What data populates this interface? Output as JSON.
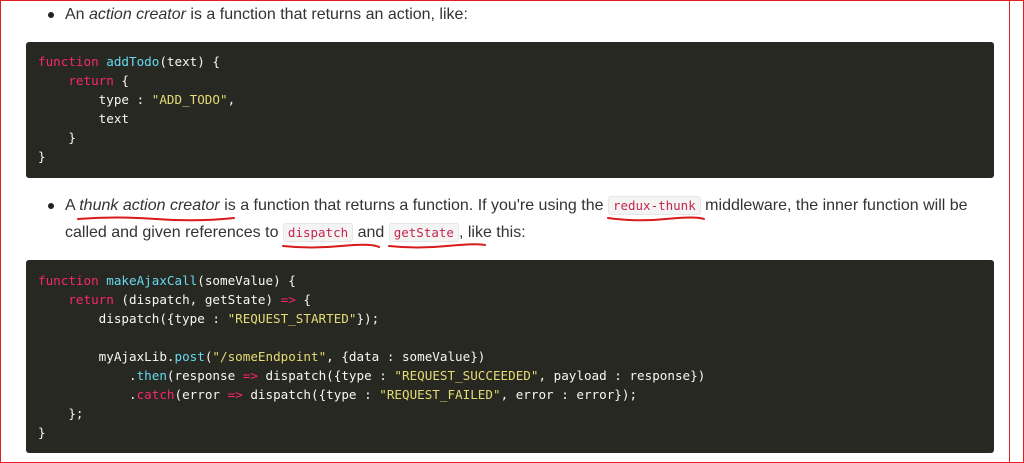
{
  "bullet1": {
    "prefix": "An ",
    "term": "action creator",
    "suffix": " is a function that returns an action, like:"
  },
  "code1": {
    "lines": [
      [
        [
          "kw",
          "function "
        ],
        [
          "fn",
          "addTodo"
        ],
        [
          "txt",
          "(text) {"
        ]
      ],
      [
        [
          "txt",
          "    "
        ],
        [
          "kw",
          "return"
        ],
        [
          "txt",
          " {"
        ]
      ],
      [
        [
          "txt",
          "        type : "
        ],
        [
          "str",
          "\"ADD_TODO\""
        ],
        [
          "txt",
          ","
        ]
      ],
      [
        [
          "txt",
          "        text"
        ]
      ],
      [
        [
          "txt",
          "    }"
        ]
      ],
      [
        [
          "txt",
          "}"
        ]
      ]
    ]
  },
  "bullet2": {
    "prefix": "A ",
    "term": "thunk action creator",
    "middle": " is a function that returns a function. If you're using the ",
    "code_redux_thunk": "redux-thunk",
    "tail1": " middleware, the inner function will be",
    "line2_prefix": "called and given references to ",
    "code_dispatch": "dispatch",
    "and": " and ",
    "code_getstate": "getState",
    "line2_suffix": ", like this:"
  },
  "code2": {
    "lines": [
      [
        [
          "kw",
          "function "
        ],
        [
          "fn",
          "makeAjaxCall"
        ],
        [
          "txt",
          "(someValue) {"
        ]
      ],
      [
        [
          "txt",
          "    "
        ],
        [
          "kw",
          "return"
        ],
        [
          "txt",
          " (dispatch, getState) "
        ],
        [
          "op",
          "=>"
        ],
        [
          "txt",
          " {"
        ]
      ],
      [
        [
          "txt",
          "        dispatch({type : "
        ],
        [
          "str",
          "\"REQUEST_STARTED\""
        ],
        [
          "txt",
          "});"
        ]
      ],
      [
        [
          "txt",
          ""
        ]
      ],
      [
        [
          "txt",
          "        myAjaxLib."
        ],
        [
          "fn",
          "post"
        ],
        [
          "txt",
          "("
        ],
        [
          "str",
          "\"/someEndpoint\""
        ],
        [
          "txt",
          ", {data : someValue})"
        ]
      ],
      [
        [
          "txt",
          "            ."
        ],
        [
          "fn",
          "then"
        ],
        [
          "txt",
          "(response "
        ],
        [
          "op",
          "=>"
        ],
        [
          "txt",
          " dispatch({type : "
        ],
        [
          "str",
          "\"REQUEST_SUCCEEDED\""
        ],
        [
          "txt",
          ", payload : response})"
        ]
      ],
      [
        [
          "txt",
          "            ."
        ],
        [
          "kw",
          "catch"
        ],
        [
          "txt",
          "(error "
        ],
        [
          "op",
          "=>"
        ],
        [
          "txt",
          " dispatch({type : "
        ],
        [
          "str",
          "\"REQUEST_FAILED\""
        ],
        [
          "txt",
          ", error : error});"
        ]
      ],
      [
        [
          "txt",
          "    };"
        ]
      ],
      [
        [
          "txt",
          "}"
        ]
      ]
    ]
  }
}
